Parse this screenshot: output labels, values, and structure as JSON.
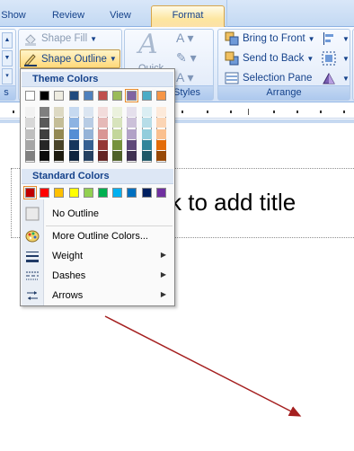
{
  "tabs": {
    "show": "Show",
    "review": "Review",
    "view": "View",
    "format": "Format"
  },
  "ribbon": {
    "shape_fill_label": "Shape Fill",
    "shape_outline_label": "Shape Outline",
    "quick_label": "Quick",
    "styles_group_label": "Styles",
    "bring_to_front_label": "Bring to Front",
    "send_to_back_label": "Send to Back",
    "selection_pane_label": "Selection Pane",
    "arrange_group_label": "Arrange"
  },
  "menu": {
    "theme_colors_heading": "Theme Colors",
    "standard_colors_heading": "Standard Colors",
    "theme_colors": [
      "#ffffff",
      "#000000",
      "#eeece1",
      "#1f497d",
      "#4f81bd",
      "#c0504d",
      "#9bbb59",
      "#8064a2",
      "#4bacc6",
      "#f79646"
    ],
    "selected_theme_color": "#8064a2",
    "theme_shades": [
      [
        "#f2f2f2",
        "#d8d8d8",
        "#bfbfbf",
        "#a5a5a5",
        "#7f7f7f"
      ],
      [
        "#7f7f7f",
        "#595959",
        "#3f3f3f",
        "#262626",
        "#0c0c0c"
      ],
      [
        "#ddd9c3",
        "#c4bd97",
        "#938953",
        "#494429",
        "#1d1b10"
      ],
      [
        "#c6d9f0",
        "#8db3e2",
        "#548dd4",
        "#17365d",
        "#0f243e"
      ],
      [
        "#dbe5f1",
        "#b8cce4",
        "#95b3d7",
        "#366092",
        "#244061"
      ],
      [
        "#f2dcdb",
        "#e5b9b7",
        "#d99694",
        "#953734",
        "#632423"
      ],
      [
        "#ebf1dd",
        "#d7e3bc",
        "#c3d69b",
        "#76923c",
        "#4f6128"
      ],
      [
        "#e5e0ec",
        "#ccc1d9",
        "#b2a2c7",
        "#5f497a",
        "#3f3151"
      ],
      [
        "#dbeef3",
        "#b7dde8",
        "#92cddc",
        "#31859b",
        "#205867"
      ],
      [
        "#fdeada",
        "#fbd5b5",
        "#fac08f",
        "#e36c09",
        "#974806"
      ]
    ],
    "standard_colors": [
      "#c00000",
      "#ff0000",
      "#ffc000",
      "#ffff00",
      "#92d050",
      "#00b050",
      "#00b0f0",
      "#0070c0",
      "#002060",
      "#7030a0"
    ],
    "selected_standard_color": "#c00000",
    "no_outline_label": "No Outline",
    "more_colors_label": "More Outline Colors...",
    "weight_label": "Weight",
    "dashes_label": "Dashes",
    "arrows_label": "Arrows"
  },
  "slide": {
    "title_placeholder_text": "ck to add title"
  }
}
